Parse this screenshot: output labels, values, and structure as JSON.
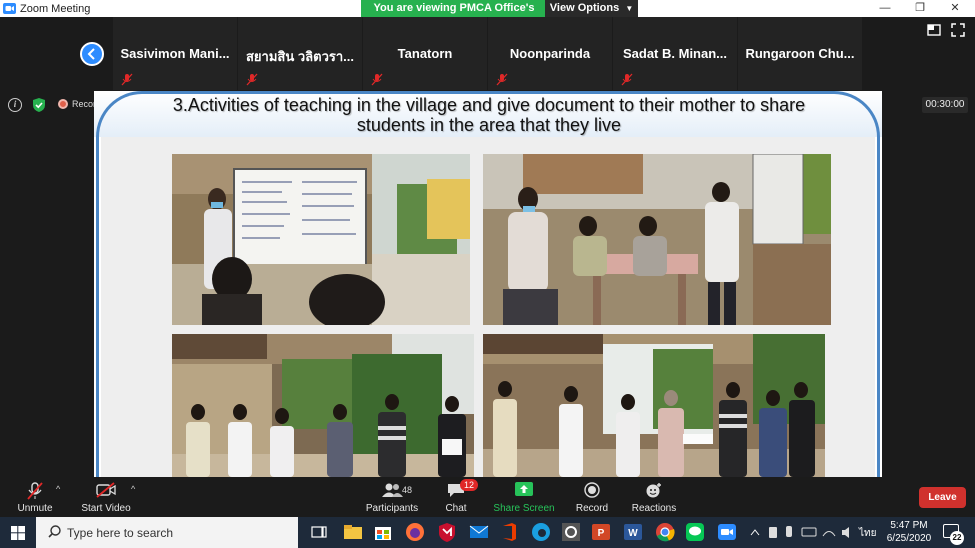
{
  "window": {
    "title": "Zoom Meeting",
    "controls": [
      "minimize",
      "restore",
      "close"
    ]
  },
  "share_banner": {
    "status": "You are viewing PMCA Office's screen",
    "view_options": "View Options"
  },
  "gallery": {
    "participants": [
      {
        "name": "Sasivimon Mani...",
        "muted": true
      },
      {
        "name": "สยามสิน วลิตวรา...",
        "muted": true
      },
      {
        "name": "Tanatorn",
        "muted": true
      },
      {
        "name": "Noonparinda",
        "muted": true
      },
      {
        "name": "Sadat B. Minan...",
        "muted": true
      },
      {
        "name": "Rungaroon Chu...",
        "muted": false
      }
    ]
  },
  "meeting_info": {
    "recording_label": "Recording",
    "timer": "00:30:00"
  },
  "slide": {
    "title_line1": "3.Activities of teaching in the village and give document to their mother to share",
    "title_line2": "students in the area that they live",
    "photos": [
      {
        "name": "photo-teaching-whiteboard"
      },
      {
        "name": "photo-outdoor-class-table"
      },
      {
        "name": "photo-students-group-holding-papers"
      },
      {
        "name": "photo-document-handover"
      }
    ]
  },
  "toolbar": {
    "unmute": "Unmute",
    "start_video": "Start Video",
    "participants": "Participants",
    "participants_count": "48",
    "chat": "Chat",
    "chat_badge": "12",
    "share_screen": "Share Screen",
    "record": "Record",
    "reactions": "Reactions",
    "leave": "Leave"
  },
  "taskbar": {
    "search_placeholder": "Type here to search",
    "time": "5:47 PM",
    "date": "6/25/2020",
    "language": "ไทย",
    "notifications": "22"
  },
  "colors": {
    "zoom_blue": "#2d8cff",
    "share_green": "#27b14f",
    "leave_red": "#d0312d",
    "slide_border": "#4a86c5"
  }
}
